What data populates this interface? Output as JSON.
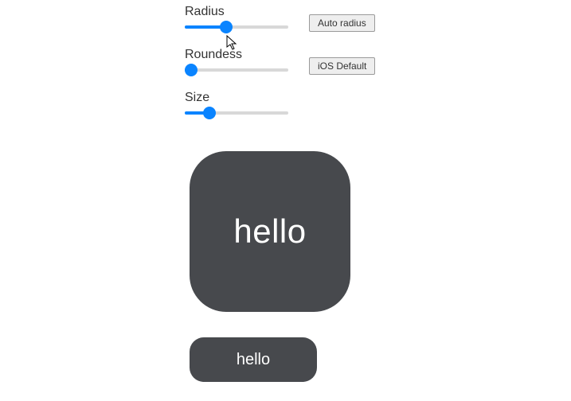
{
  "controls": {
    "radius": {
      "label": "Radius",
      "value_pct": 40,
      "button_label": "Auto radius"
    },
    "roundess": {
      "label": "Roundess",
      "value_pct": 6,
      "button_label": "iOS Default"
    },
    "size": {
      "label": "Size",
      "value_pct": 24
    }
  },
  "preview": {
    "large_text": "hello",
    "small_text": "hello",
    "shape_color": "#47494d",
    "text_color": "#ffffff"
  }
}
